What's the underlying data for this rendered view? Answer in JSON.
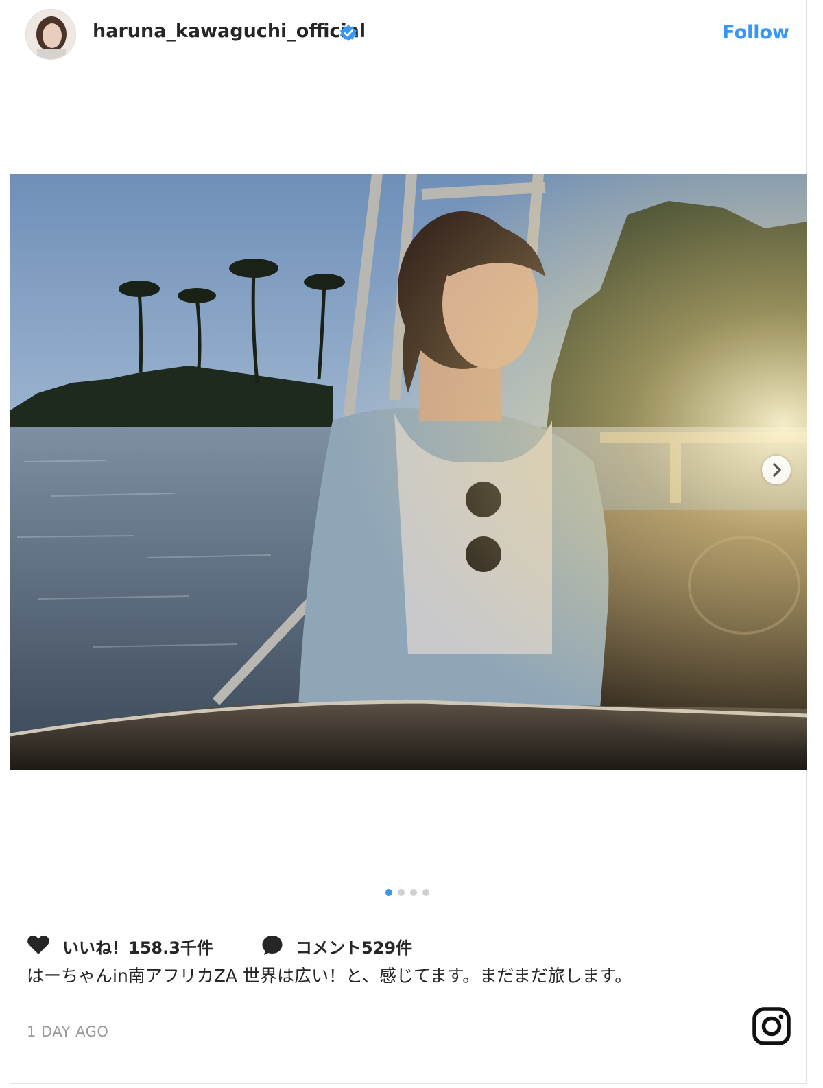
{
  "post": {
    "username": "haruna_kawaguchi_official",
    "follow_label": "Follow",
    "likes_text": "いいね！158.3千件",
    "comments_text": "コメント529件",
    "caption": "はーちゃんin南アフリカZA 世界は広い！と、感じてます。まだまだ旅します。",
    "timestamp": "1 DAY AGO",
    "carousel": {
      "total_slides": 4,
      "active_slide": 1
    }
  },
  "icons": {
    "verified": "verified-badge-icon",
    "heart": "heart-icon",
    "comment": "comment-bubble-icon",
    "next": "chevron-right-icon",
    "instagram": "instagram-logo-icon"
  },
  "colors": {
    "accent": "#3897f0",
    "text": "#262626",
    "muted": "#999999"
  }
}
